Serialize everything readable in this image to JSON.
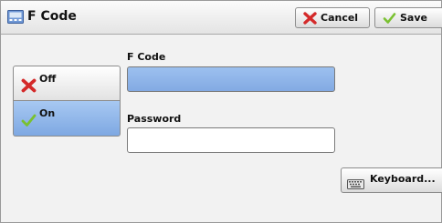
{
  "header": {
    "title": "F Code",
    "title_icon": "fcode-screen-icon",
    "cancel_label": "Cancel",
    "cancel_icon": "red-x-icon",
    "save_label": "Save",
    "save_icon": "green-check-icon"
  },
  "options": {
    "selected": "On",
    "items": [
      {
        "label": "Off",
        "icon": "red-x-icon"
      },
      {
        "label": "On",
        "icon": "green-check-icon"
      }
    ]
  },
  "fields": {
    "fcode_label": "F Code",
    "fcode_value": "",
    "password_label": "Password",
    "password_value": ""
  },
  "keyboard": {
    "label": "Keyboard...",
    "icon": "keyboard-icon"
  },
  "colors": {
    "selected_blue": "#8fb4e9",
    "cancel_red": "#d42a2a",
    "save_green": "#7ac131"
  }
}
